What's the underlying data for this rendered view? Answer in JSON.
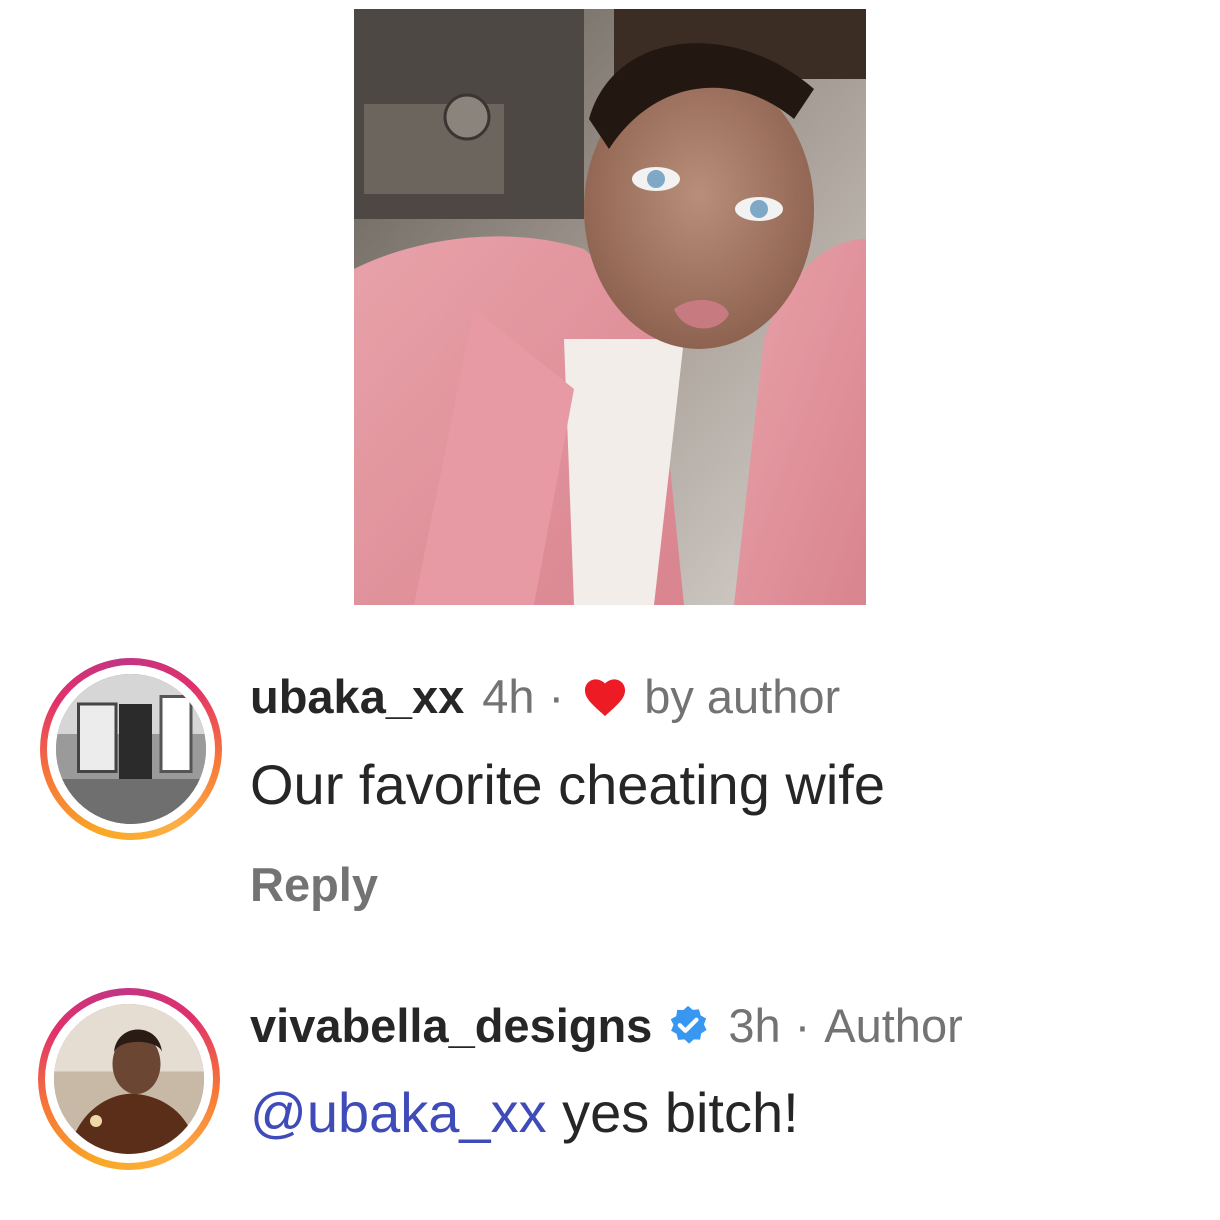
{
  "post": {
    "image_desc_icon": "photo-selfie"
  },
  "comments": [
    {
      "username": "ubaka_xx",
      "time": "4h",
      "separator": "·",
      "liked_label": "by author",
      "text": "Our favorite cheating wife",
      "reply_label": "Reply"
    },
    {
      "username": "vivabella_designs",
      "verified": true,
      "time": "3h",
      "separator": "·",
      "author_tag": "Author",
      "mention": "@ubaka_xx",
      "text": " yes bitch!"
    }
  ],
  "colors": {
    "heart": "#ed1c24",
    "verified": "#3897f0",
    "mention": "#3e4bb8",
    "muted": "#737373"
  }
}
